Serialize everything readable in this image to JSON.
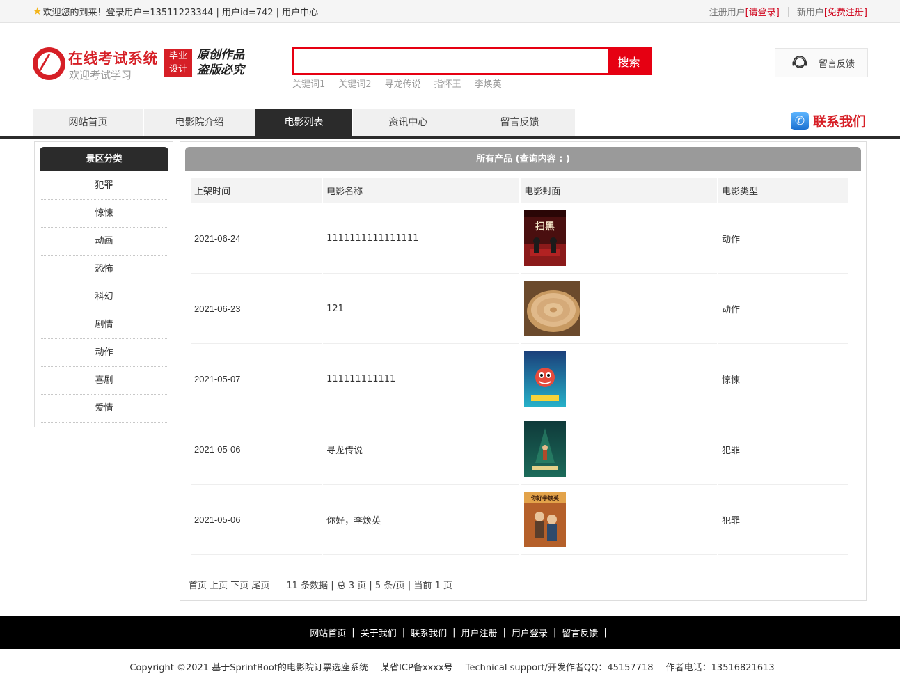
{
  "topbar": {
    "welcome": "欢迎您的到来！登录用户=13511223344 | 用户id=742 | 用户中心",
    "register_label": "注册用户",
    "login_link": "[请登录]",
    "new_user_label": "新用户",
    "signup_link": "[免费注册]"
  },
  "logo": {
    "title": "在线考试系统",
    "subtitle": "欢迎考试学习",
    "badge_line1": "毕业",
    "badge_line2": "设计",
    "slogan_line1": "原创作品",
    "slogan_line2": "盗版必究"
  },
  "search": {
    "value": "",
    "button_label": "搜索",
    "hotwords": [
      "关键词1",
      "关键词2",
      "寻龙传说",
      "指怀王",
      "李焕英"
    ]
  },
  "feedback_button": "留言反馈",
  "nav": {
    "items": [
      "网站首页",
      "电影院介绍",
      "电影列表",
      "资讯中心",
      "留言反馈"
    ],
    "active": "电影列表",
    "contact": "联系我们"
  },
  "sidebar": {
    "title": "景区分类",
    "categories": [
      "犯罪",
      "惊悚",
      "动画",
      "恐怖",
      "科幻",
      "剧情",
      "动作",
      "喜剧",
      "爱情"
    ]
  },
  "main": {
    "title": "所有产品 (查询内容 : )",
    "columns": [
      "上架时间",
      "电影名称",
      "电影封面",
      "电影类型"
    ],
    "rows": [
      {
        "date": "2021-06-24",
        "name": "1111111111111111",
        "type": "动作",
        "cover_label": "扫黑"
      },
      {
        "date": "2021-06-23",
        "name": "121",
        "type": "动作",
        "cover_label": ""
      },
      {
        "date": "2021-05-07",
        "name": "111111111111",
        "type": "惊悚",
        "cover_label": ""
      },
      {
        "date": "2021-05-06",
        "name": "寻龙传说",
        "type": "犯罪",
        "cover_label": ""
      },
      {
        "date": "2021-05-06",
        "name": "你好，李焕英",
        "type": "犯罪",
        "cover_label": "你好李焕英"
      }
    ],
    "pager": {
      "links": "首页 上页 下页 尾页",
      "summary": "11 条数据 | 总 3 页 | 5 条/页 | 当前 1 页"
    }
  },
  "footer": {
    "links": [
      "网站首页",
      "关于我们",
      "联系我们",
      "用户注册",
      "用户登录",
      "留言反馈"
    ],
    "copyright": "Copyright ©2021 基于SprintBoot的电影院订票选座系统",
    "icp": "某省ICP备xxxx号",
    "support": "Technical support/开发作者QQ：45157718",
    "phone": "作者电话：13516821613"
  },
  "colors": {
    "brand_red": "#d61f26",
    "search_red": "#e60012",
    "dark": "#2b2b2b",
    "grey_header": "#9a9a9a"
  }
}
